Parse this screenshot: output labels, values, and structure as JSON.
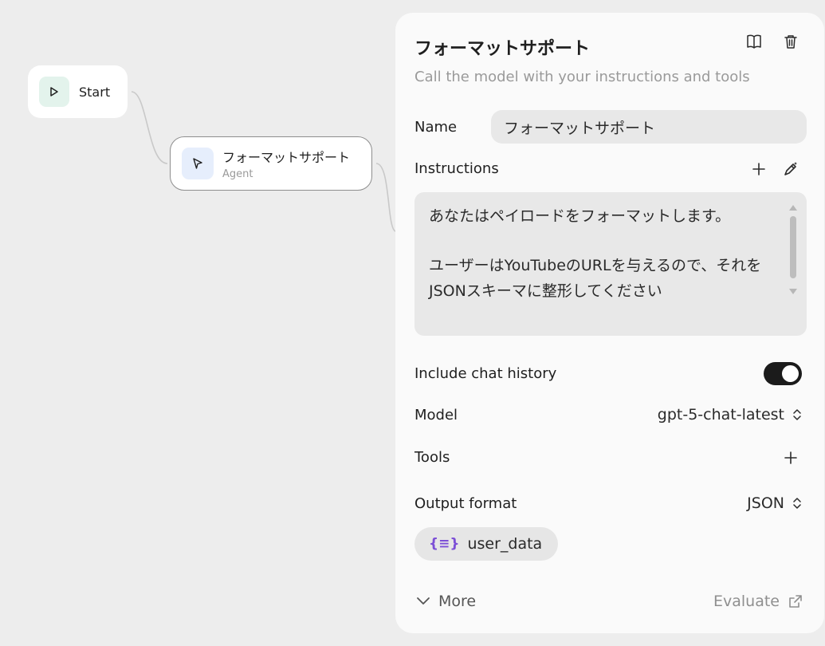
{
  "canvas": {
    "start_node": {
      "label": "Start",
      "icon": "play-icon"
    },
    "agent_node": {
      "title": "フォーマットサポート",
      "subtitle": "Agent",
      "icon": "cursor-icon"
    }
  },
  "panel": {
    "title": "フォーマットサポート",
    "subtitle": "Call the model with your instructions and tools",
    "header_icons": [
      "book-icon",
      "trash-icon"
    ],
    "name": {
      "label": "Name",
      "value": "フォーマットサポート"
    },
    "instructions": {
      "label": "Instructions",
      "line1": "あなたはペイロードをフォーマットします。",
      "line2": "ユーザーはYouTubeのURLを与えるので、それをJSONスキーマに整形してください"
    },
    "chat_history": {
      "label": "Include chat history",
      "enabled": true
    },
    "model": {
      "label": "Model",
      "value": "gpt-5-chat-latest"
    },
    "tools": {
      "label": "Tools"
    },
    "output_format": {
      "label": "Output format",
      "value": "JSON"
    },
    "schema_chip": {
      "label": "user_data",
      "icon": "json-braces-icon"
    },
    "footer": {
      "more_label": "More",
      "evaluate_label": "Evaluate"
    }
  },
  "colors": {
    "canvas_bg": "#ededed",
    "panel_bg": "#fafafa",
    "field_bg": "#e8e8e8",
    "toggle_on": "#1b1b1b",
    "chip_icon": "#7c4fd6"
  }
}
